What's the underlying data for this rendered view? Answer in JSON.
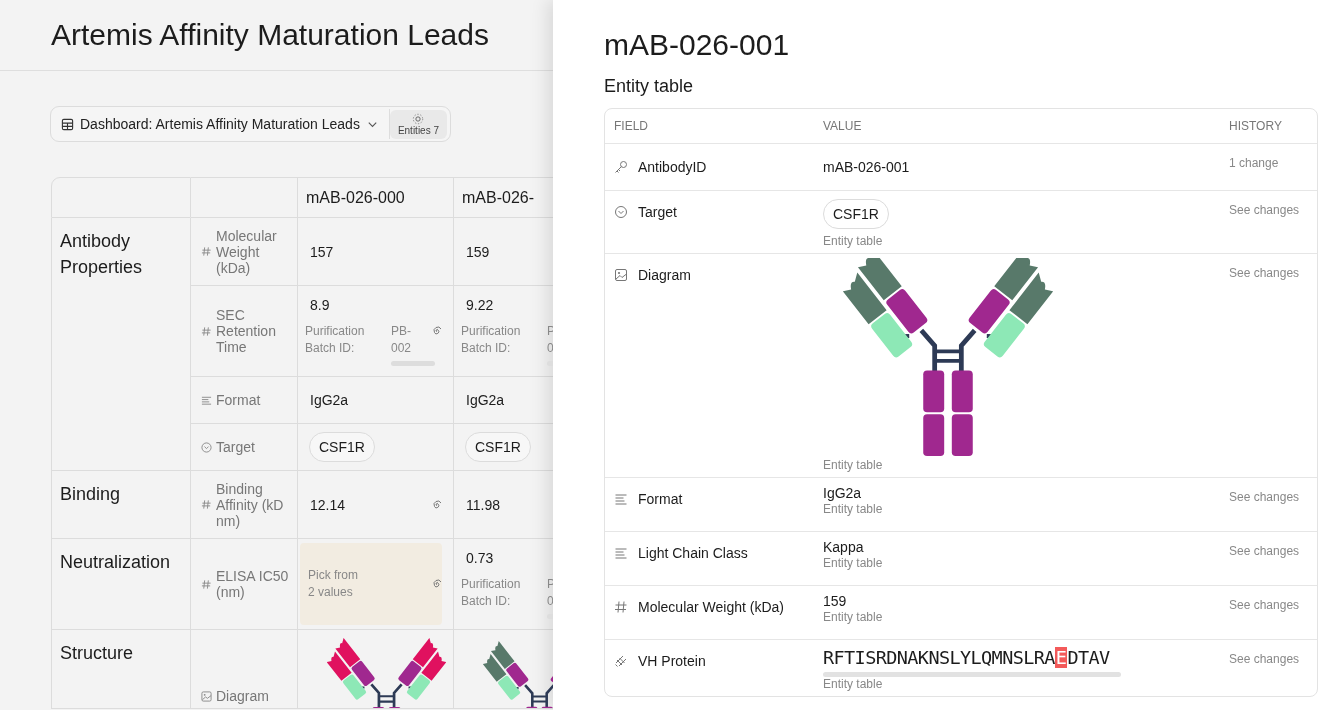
{
  "page": {
    "title": "Artemis Affinity Maturation Leads",
    "toolbar": {
      "dashboard": "Dashboard: Artemis Affinity Maturation Leads",
      "entities": "Entities 7"
    },
    "table": {
      "columns": [
        "mAB-026-000",
        "mAB-026-"
      ],
      "groups": [
        {
          "name": "Antibody Properties",
          "rows": [
            {
              "field": "Molecular Weight (kDa)",
              "kind": "number",
              "cells": [
                {
                  "kind": "text",
                  "value": "157",
                  "linked": false
                },
                {
                  "kind": "text",
                  "value": "159",
                  "linked": false
                }
              ]
            },
            {
              "field": "SEC Retention Time",
              "kind": "number",
              "cells": [
                {
                  "kind": "batch",
                  "value": "8.9",
                  "batch_label": "Purification Batch ID:",
                  "batch_id": [
                    "PB-",
                    "002"
                  ],
                  "linked": true
                },
                {
                  "kind": "batch",
                  "value": "9.22",
                  "batch_label": "Purification Batch ID:",
                  "batch_id": [
                    "P",
                    "0"
                  ],
                  "linked": false
                }
              ]
            },
            {
              "field": "Format",
              "kind": "text",
              "cells": [
                {
                  "kind": "text",
                  "value": "IgG2a",
                  "linked": false
                },
                {
                  "kind": "text",
                  "value": "IgG2a",
                  "linked": false
                }
              ]
            },
            {
              "field": "Target",
              "kind": "select",
              "cells": [
                {
                  "kind": "pill",
                  "value": "CSF1R",
                  "linked": false
                },
                {
                  "kind": "pill",
                  "value": "CSF1R",
                  "linked": false
                }
              ]
            }
          ]
        },
        {
          "name": "Binding",
          "rows": [
            {
              "field": "Binding Affinity (kD nm)",
              "kind": "number",
              "cells": [
                {
                  "kind": "text",
                  "value": "12.14",
                  "linked": true
                },
                {
                  "kind": "text",
                  "value": "11.98",
                  "linked": false
                }
              ]
            }
          ]
        },
        {
          "name": "Neutralization",
          "rows": [
            {
              "field": "ELISA IC50 (nm)",
              "kind": "number",
              "cells": [
                {
                  "kind": "pick",
                  "lines": [
                    "Pick from",
                    "2 values"
                  ],
                  "linked": true
                },
                {
                  "kind": "batch",
                  "value": "0.73",
                  "batch_label": "Purification Batch ID:",
                  "batch_id": [
                    "P",
                    "0"
                  ],
                  "linked": false
                }
              ]
            }
          ]
        },
        {
          "name": "Structure",
          "rows": [
            {
              "field": "Diagram",
              "kind": "image",
              "cells": [
                {
                  "kind": "diagram",
                  "linked": false
                },
                {
                  "kind": "diagram",
                  "linked": false
                }
              ]
            }
          ]
        }
      ]
    }
  },
  "panel": {
    "title": "mAB-026-001",
    "subtitle": "Entity table",
    "columns": [
      "FIELD",
      "VALUE",
      "HISTORY"
    ],
    "rows": [
      {
        "field": "AntibodyID",
        "kind": "key",
        "value": "mAB-026-001",
        "history": "1 change"
      },
      {
        "field": "Target",
        "kind": "select",
        "value": "CSF1R",
        "source": "Entity table",
        "history": "See changes"
      },
      {
        "field": "Diagram",
        "kind": "image",
        "source": "Entity table",
        "history": "See changes"
      },
      {
        "field": "Format",
        "kind": "text",
        "value": "IgG2a",
        "source": "Entity table",
        "history": "See changes"
      },
      {
        "field": "Light Chain Class",
        "kind": "text",
        "value": "Kappa",
        "source": "Entity table",
        "history": "See changes"
      },
      {
        "field": "Molecular Weight (kDa)",
        "kind": "number",
        "value": "159",
        "source": "Entity table",
        "history": "See changes"
      },
      {
        "field": "VH Protein",
        "kind": "sequence",
        "sequence": [
          "RFTISRDNAKNSLYLQMNSLRA",
          "E",
          "DTAV"
        ],
        "source": "Entity table",
        "history": "See changes"
      }
    ]
  }
}
